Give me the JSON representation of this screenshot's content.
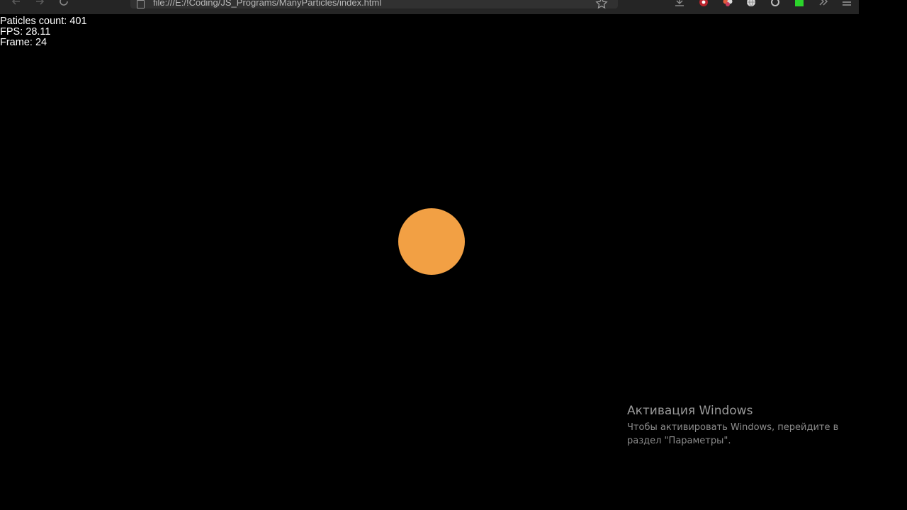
{
  "browser": {
    "url": "file:///E:/!Coding/JS_Programs/ManyParticles/index.html",
    "icons": {
      "back": "arrow-left-icon",
      "forward": "arrow-right-icon",
      "reload": "reload-icon",
      "page": "page-icon",
      "bookmark": "star-icon",
      "downloads": "download-icon",
      "extensions": [
        "extension-red-icon",
        "extension-multicolor-icon",
        "extension-globe-icon",
        "extension-ring-icon",
        "extension-green-icon"
      ],
      "overflow": "chevrons-right-icon",
      "menu": "hamburger-menu-icon"
    }
  },
  "stats": {
    "particles": "Paticles count: 401",
    "fps": "FPS: 28.11",
    "frame": "Frame: 24"
  },
  "particle": {
    "color": "#F2A044"
  },
  "watermark": {
    "title": "Активация Windows",
    "body": "Чтобы активировать Windows, перейдите в раздел \"Параметры\"."
  }
}
